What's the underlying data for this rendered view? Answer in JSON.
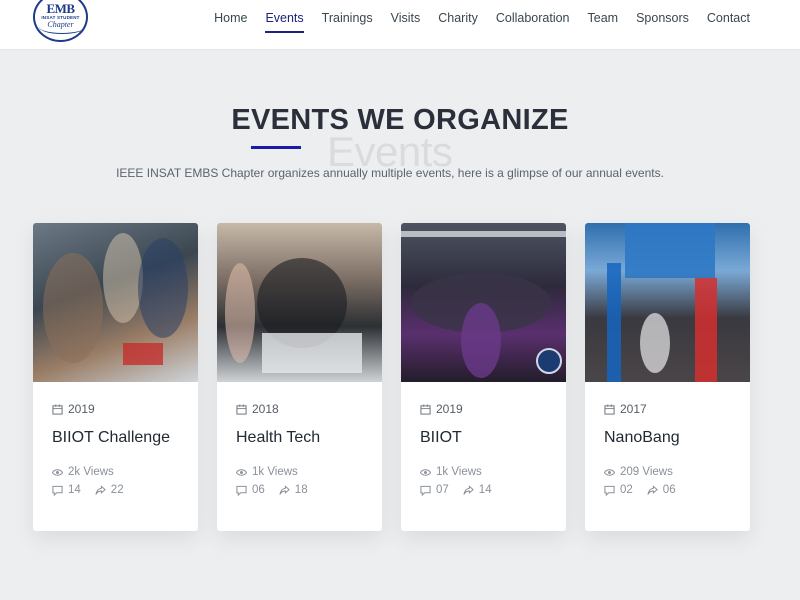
{
  "brand": {
    "logo_line1": "EMB",
    "logo_line2": "INSAT STUDENT",
    "logo_line3": "Chapter"
  },
  "nav": {
    "items": [
      {
        "label": "Home"
      },
      {
        "label": "Events",
        "active": true
      },
      {
        "label": "Trainings"
      },
      {
        "label": "Visits"
      },
      {
        "label": "Charity"
      },
      {
        "label": "Collaboration"
      },
      {
        "label": "Team"
      },
      {
        "label": "Sponsors"
      },
      {
        "label": "Contact"
      }
    ]
  },
  "section": {
    "title": "EVENTS WE ORGANIZE",
    "ghost": "Events",
    "subtitle": "IEEE INSAT EMBS Chapter organizes annually multiple events, here is a glimpse of our annual events."
  },
  "events": [
    {
      "year": "2019",
      "title": "BIIOT Challenge",
      "views": "2k Views",
      "comments": "14",
      "shares": "22"
    },
    {
      "year": "2018",
      "title": "Health Tech",
      "views": "1k Views",
      "comments": "06",
      "shares": "18"
    },
    {
      "year": "2019",
      "title": "BIIOT",
      "views": "1k Views",
      "comments": "07",
      "shares": "14"
    },
    {
      "year": "2017",
      "title": "NanoBang",
      "views": "209 Views",
      "comments": "02",
      "shares": "06"
    }
  ],
  "colors": {
    "accent": "#1a237e",
    "background": "#eceef0",
    "card": "#ffffff"
  },
  "icons": {
    "date": "calendar-icon",
    "views": "eye-icon",
    "comments": "comment-icon",
    "shares": "share-icon"
  }
}
